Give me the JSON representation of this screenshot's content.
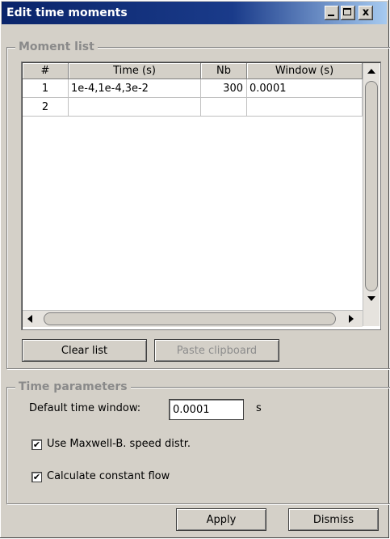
{
  "window": {
    "title": "Edit time moments",
    "controls": {
      "minimize": "minimize-icon",
      "maximize": "maximize-icon",
      "close": "x"
    }
  },
  "moment_list": {
    "legend": "Moment list",
    "columns": [
      "#",
      "Time (s)",
      "Nb",
      "Window (s)"
    ],
    "rows": [
      {
        "index": "1",
        "time": "1e-4,1e-4,3e-2",
        "nb": "300",
        "window": "0.0001"
      },
      {
        "index": "2",
        "time": "",
        "nb": "",
        "window": ""
      }
    ],
    "buttons": {
      "clear": "Clear list",
      "paste": "Paste clipboard"
    }
  },
  "time_parameters": {
    "legend": "Time parameters",
    "default_window_label": "Default time window:",
    "default_window_value": "0.0001",
    "unit": "s",
    "checkboxes": [
      {
        "label": "Use Maxwell-B. speed distr.",
        "checked": true
      },
      {
        "label": "Calculate constant flow",
        "checked": true
      }
    ]
  },
  "footer": {
    "apply": "Apply",
    "dismiss": "Dismiss"
  }
}
